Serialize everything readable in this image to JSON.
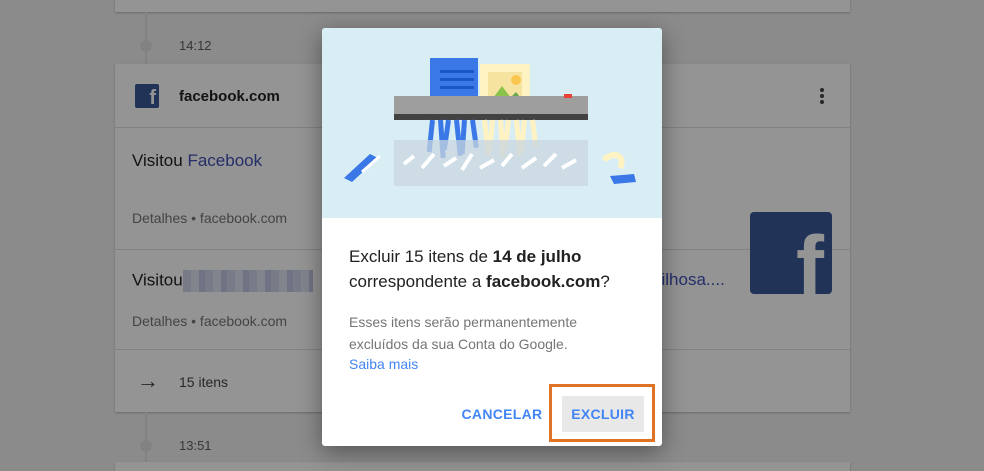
{
  "background": {
    "time_top": "14:12",
    "time_bottom": "13:51",
    "card": {
      "site": "facebook.com",
      "visit1": {
        "prefix": "Visitou ",
        "link": "Facebook",
        "details": "Detalhes • facebook.com"
      },
      "visit2": {
        "prefix": "Visitou",
        "link_tail": "vilhosa....",
        "details": "Detalhes • facebook.com"
      },
      "items_count": "15 itens"
    }
  },
  "dialog": {
    "title_part1": "Excluir 15 itens de ",
    "title_date": "14 de julho",
    "title_part2": "correspondente a ",
    "title_site": "facebook.com",
    "title_end": "?",
    "body": "Esses itens serão permanentemente excluídos da sua Conta do Google.",
    "learn_more": "Saiba mais",
    "cancel_label": "CANCELAR",
    "delete_label": "EXCLUIR"
  },
  "colors": {
    "accent": "#4285f4",
    "highlight": "#e07224",
    "facebook": "#3b5998"
  }
}
